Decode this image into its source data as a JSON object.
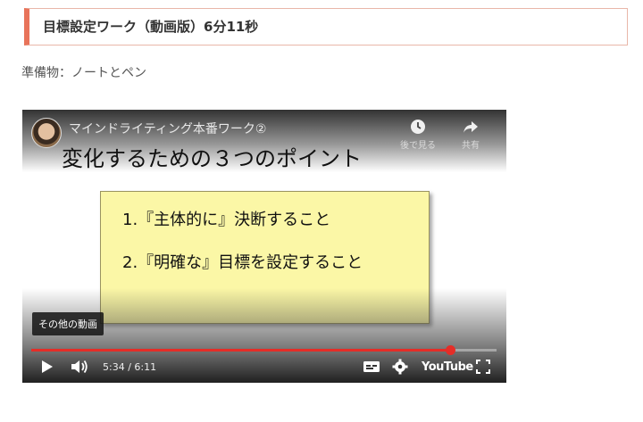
{
  "section": {
    "heading": "目標設定ワーク（動画版）6分11秒",
    "preparation": "準備物：ノートとペン"
  },
  "video": {
    "channel_title": "マインドライティング本番ワーク②",
    "slide_title": "変化するための３つのポイント",
    "slide_points": [
      "1.『主体的に』決断すること",
      "2.『明確な』目標を設定すること"
    ],
    "watch_later_label": "後で見る",
    "share_label": "共有",
    "more_videos_label": "その他の動画",
    "current_time": "5:34",
    "duration": "6:11",
    "time_display": "5:34 / 6:11",
    "progress_fraction": 0.9,
    "youtube_logo": "YouTube"
  },
  "colors": {
    "heading_accent": "#e8735a",
    "slide_background": "#fbf7a6",
    "progress_red": "#e52d27"
  },
  "icons": [
    "clock-icon",
    "share-icon",
    "play-icon",
    "volume-icon",
    "captions-icon",
    "settings-icon",
    "fullscreen-icon"
  ]
}
